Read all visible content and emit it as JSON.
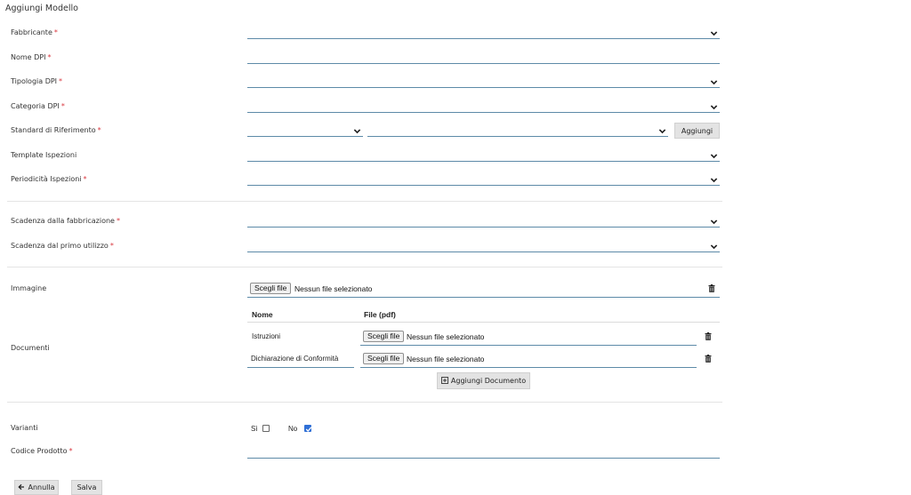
{
  "title": "Aggiungi Modello",
  "required_mark": "*",
  "fields": {
    "fabbricante": "Fabbricante",
    "nome_dpi": "Nome DPI",
    "tipologia_dpi": "Tipologia DPI",
    "categoria_dpi": "Categoria DPI",
    "standard": "Standard di Riferimento",
    "template": "Template Ispezioni",
    "periodicita": "Periodicità Ispezioni",
    "scadenza_fabbricazione": "Scadenza dalla fabbricazione",
    "scadenza_utilizzo": "Scadenza dal primo utilizzo",
    "immagine": "Immagine",
    "documenti": "Documenti",
    "varianti": "Varianti",
    "codice_prodotto": "Codice Prodotto"
  },
  "aggiungi_label": "Aggiungi",
  "file_button_label": "Scegli file",
  "no_file_label": "Nessun file selezionato",
  "documents_table": {
    "headers": [
      "Nome",
      "File (pdf)"
    ],
    "rows": [
      {
        "name": "Istruzioni"
      },
      {
        "name": "Dichiarazione di Conformità"
      }
    ],
    "add_label": "Aggiungi Documento"
  },
  "varianti": {
    "si_label": "Sì",
    "no_label": "No",
    "si_checked": false,
    "no_checked": true
  },
  "footer": {
    "annulla_label": "Annulla",
    "salva_label": "Salva"
  },
  "colors": {
    "accent": "#5d8aa8",
    "required": "#d9363e",
    "checkbox": "#2f6fd6"
  }
}
